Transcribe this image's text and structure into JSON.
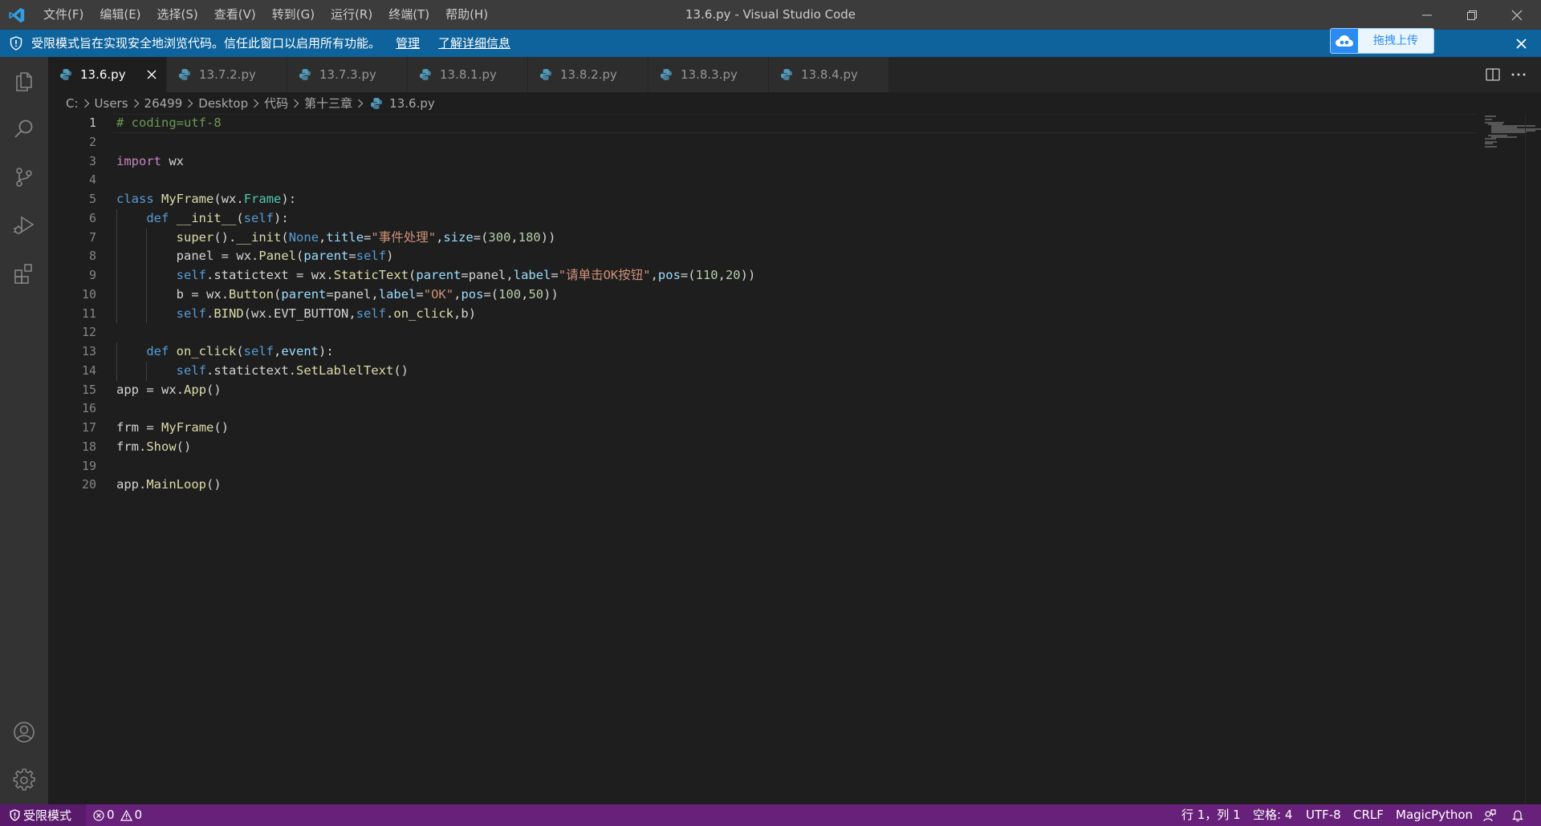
{
  "app": {
    "window_title": "13.6.py - Visual Studio Code",
    "menu": [
      "文件(F)",
      "编辑(E)",
      "选择(S)",
      "查看(V)",
      "转到(G)",
      "运行(R)",
      "终端(T)",
      "帮助(H)"
    ]
  },
  "banner": {
    "text": "受限模式旨在实现安全地浏览代码。信任此窗口以启用所有功能。",
    "manage_link": "管理",
    "learn_more_link": "了解详细信息",
    "upload_button": "拖拽上传"
  },
  "tabs": [
    {
      "label": "13.6.py",
      "active": true
    },
    {
      "label": "13.7.2.py",
      "active": false
    },
    {
      "label": "13.7.3.py",
      "active": false
    },
    {
      "label": "13.8.1.py",
      "active": false
    },
    {
      "label": "13.8.2.py",
      "active": false
    },
    {
      "label": "13.8.3.py",
      "active": false
    },
    {
      "label": "13.8.4.py",
      "active": false
    }
  ],
  "breadcrumb": [
    "C:",
    "Users",
    "26499",
    "Desktop",
    "代码",
    "第十三章",
    "13.6.py"
  ],
  "editor": {
    "line_numbers": [
      "1",
      "2",
      "3",
      "4",
      "5",
      "6",
      "7",
      "8",
      "9",
      "10",
      "11",
      "12",
      "13",
      "14",
      "15",
      "16",
      "17",
      "18",
      "19",
      "20"
    ],
    "code_lines": [
      "# coding=utf-8",
      "",
      "import wx",
      "",
      "class MyFrame(wx.Frame):",
      "    def __init__(self):",
      "        super().__init(None,title=\"事件处理\",size=(300,180))",
      "        panel = wx.Panel(parent=self)",
      "        self.statictext = wx.StaticText(parent=panel,label=\"请单击OK按钮\",pos=(110,20))",
      "        b = wx.Button(parent=panel,label=\"OK\",pos=(100,50))",
      "        self.BIND(wx.EVT_BUTTON,self.on_click,b)",
      "",
      "    def on_click(self,event):",
      "        self.statictext.SetLablelText()",
      "app = wx.App()",
      "",
      "frm = MyFrame()",
      "frm.Show()",
      "",
      "app.MainLoop()"
    ]
  },
  "statusbar": {
    "mode": "受限模式",
    "errors": "0",
    "warnings": "0",
    "position": "行 1，列 1",
    "indent": "空格: 4",
    "encoding": "UTF-8",
    "eol": "CRLF",
    "language": "MagicPython"
  },
  "colors": {
    "titlebar": "#3c3c3c",
    "banner": "#0e639c",
    "activitybar": "#333333",
    "editor_bg": "#1e1e1e",
    "statusbar": "#68217a"
  },
  "icons": [
    "vscode-logo-icon",
    "shield-icon",
    "cloud-upload-icon",
    "close-icon",
    "explorer-icon",
    "search-icon",
    "source-control-icon",
    "run-debug-icon",
    "extensions-icon",
    "account-icon",
    "settings-gear-icon",
    "python-file-icon",
    "split-editor-icon",
    "more-actions-icon",
    "error-icon",
    "warning-icon",
    "feedback-icon",
    "bell-icon"
  ]
}
